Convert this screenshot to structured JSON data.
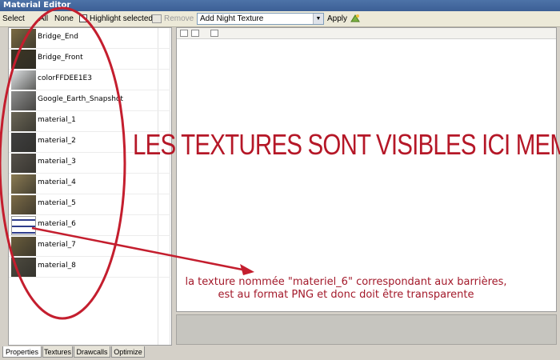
{
  "window": {
    "title": "Material Editor"
  },
  "toolbar": {
    "select_label": "Select",
    "all_label": "All",
    "none_label": "None",
    "highlight_label": "Highlight selected",
    "remove_label": "Remove",
    "add_night_texture_label": "Add Night Texture",
    "apply_label": "Apply"
  },
  "textures": [
    {
      "name": "Bridge_End",
      "thumb_color": "#7a6a43"
    },
    {
      "name": "Bridge_Front",
      "thumb_color": "#3c3624"
    },
    {
      "name": "colorFFDEE1E3",
      "thumb_color": "#dee1e3"
    },
    {
      "name": "Google_Earth_Snapshot",
      "thumb_color": "#8d8d8d"
    },
    {
      "name": "material_1",
      "thumb_color": "#6b6656"
    },
    {
      "name": "material_2",
      "thumb_color": "#404040"
    },
    {
      "name": "material_3",
      "thumb_color": "#56514a"
    },
    {
      "name": "material_4",
      "thumb_color": "#8a7a52"
    },
    {
      "name": "material_5",
      "thumb_color": "#7b6a46"
    },
    {
      "name": "material_6",
      "thumb_color": "#ffffff"
    },
    {
      "name": "material_7",
      "thumb_color": "#6a5d3c"
    },
    {
      "name": "material_8",
      "thumb_color": "#4d4a3f"
    }
  ],
  "tabs": [
    {
      "label": "Properties",
      "active": true
    },
    {
      "label": "Textures",
      "active": false
    },
    {
      "label": "Drawcalls",
      "active": false
    },
    {
      "label": "Optimize",
      "active": false
    }
  ],
  "annotations": {
    "headline": "LES TEXTURES SONT VISIBLES ICI MEME",
    "note_line1": "la texture nommée \"materiel_6\"  correspondant aux barrières,",
    "note_line2": "est au format PNG et donc doit être transparente"
  },
  "colors": {
    "annotation_red": "#b51727",
    "titlebar_blue": "#4d73a8"
  }
}
